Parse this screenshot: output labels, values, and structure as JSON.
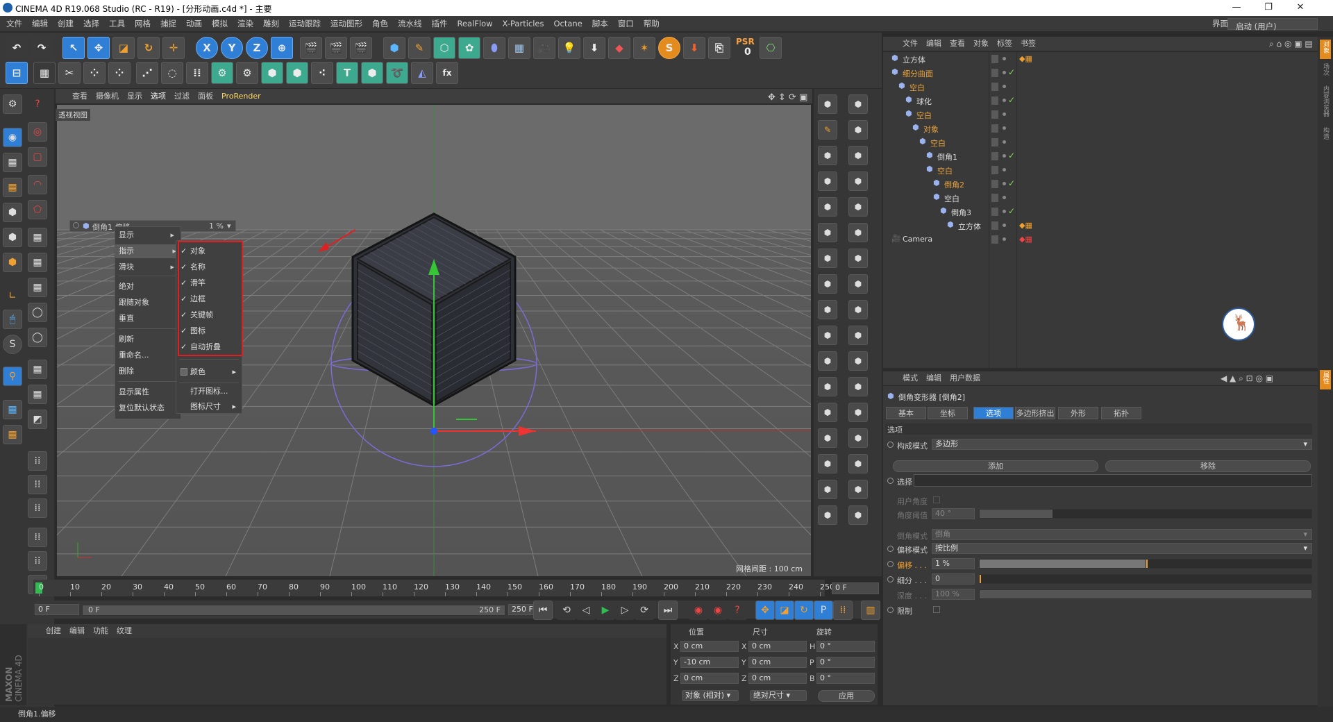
{
  "window": {
    "title": "CINEMA 4D R19.068 Studio (RC - R19) - [分形动画.c4d *] - 主要",
    "minimize": "—",
    "maximize": "❐",
    "close": "✕",
    "layout_label": "界面:",
    "layout_value": "启动 (用户)"
  },
  "menubar": [
    "文件",
    "编辑",
    "创建",
    "选择",
    "工具",
    "网格",
    "捕捉",
    "动画",
    "模拟",
    "渲染",
    "雕刻",
    "运动跟踪",
    "运动图形",
    "角色",
    "流水线",
    "插件",
    "RealFlow",
    "X-Particles",
    "Octane",
    "脚本",
    "窗口",
    "帮助"
  ],
  "top_toolbar": {
    "x_label": "X",
    "y_label": "Y",
    "z_label": "Z",
    "psr_label": "PSR",
    "psr_value": "0"
  },
  "viewport": {
    "menu": [
      "查看",
      "摄像机",
      "显示",
      "选项",
      "过滤",
      "面板",
      "ProRender"
    ],
    "label": "透视视图",
    "grid_readout": "网格间距 : 100 cm",
    "popup_object": "倒角1 偏移",
    "popup_value": "1 %"
  },
  "context_menu": {
    "items": [
      {
        "label": "显示",
        "arrow": "▸"
      },
      {
        "label": "指示",
        "arrow": "▸"
      },
      {
        "label": "滑块",
        "arrow": "▸"
      },
      {
        "label": "绝对"
      },
      {
        "label": "跟随对象"
      },
      {
        "label": "垂直"
      },
      {
        "label": "刷新"
      },
      {
        "label": "重命名..."
      },
      {
        "label": "删除"
      },
      {
        "label": "显示属性"
      },
      {
        "label": "复位默认状态"
      }
    ],
    "submenu": [
      {
        "label": "对象",
        "check": "✓"
      },
      {
        "label": "名称",
        "check": "✓"
      },
      {
        "label": "滑竿",
        "check": "✓"
      },
      {
        "label": "边框",
        "check": "✓"
      },
      {
        "label": "关键帧",
        "check": "✓"
      },
      {
        "label": "图标",
        "check": "✓"
      },
      {
        "label": "自动折叠",
        "check": "✓"
      },
      {
        "label": "颜色",
        "arrow": "▸"
      },
      {
        "label": "打开图标..."
      },
      {
        "label": "图标尺寸",
        "arrow": "▸"
      }
    ]
  },
  "timeline": {
    "ticks": [
      "0",
      "10",
      "20",
      "30",
      "40",
      "50",
      "60",
      "70",
      "80",
      "90",
      "100",
      "110",
      "120",
      "130",
      "140",
      "150",
      "160",
      "170",
      "180",
      "190",
      "200",
      "210",
      "220",
      "230",
      "240",
      "250"
    ],
    "current_frame": "0 F",
    "start_field": "0 F",
    "slider_start": "0 F",
    "slider_end": "250 F",
    "end_field": "250 F"
  },
  "object_manager": {
    "menu": [
      "文件",
      "编辑",
      "查看",
      "对象",
      "标签",
      "书签"
    ],
    "rows": [
      {
        "name": "立方体",
        "indent": 0,
        "color": "#dddddd",
        "check": ""
      },
      {
        "name": "细分曲面",
        "indent": 0,
        "color": "#e9a33b",
        "check": "✓"
      },
      {
        "name": "空白",
        "indent": 1,
        "color": "#e9a33b",
        "check": ""
      },
      {
        "name": "球化",
        "indent": 2,
        "color": "#dddddd",
        "check": "✓"
      },
      {
        "name": "空白",
        "indent": 2,
        "color": "#e9a33b",
        "check": ""
      },
      {
        "name": "对象",
        "indent": 3,
        "color": "#e9a33b",
        "check": ""
      },
      {
        "name": "空白",
        "indent": 4,
        "color": "#e9a33b",
        "check": ""
      },
      {
        "name": "倒角1",
        "indent": 5,
        "color": "#dddddd",
        "check": "✓"
      },
      {
        "name": "空白",
        "indent": 5,
        "color": "#e9a33b",
        "check": ""
      },
      {
        "name": "倒角2",
        "indent": 6,
        "color": "#e9a33b",
        "check": "✓"
      },
      {
        "name": "空白",
        "indent": 6,
        "color": "#dddddd",
        "check": ""
      },
      {
        "name": "倒角3",
        "indent": 7,
        "color": "#dddddd",
        "check": "✓"
      },
      {
        "name": "立方体",
        "indent": 8,
        "color": "#dddddd",
        "check": ""
      },
      {
        "name": "Camera",
        "indent": 0,
        "color": "#dddddd",
        "check": ""
      }
    ]
  },
  "attribute_manager": {
    "menu": [
      "模式",
      "编辑",
      "用户数据"
    ],
    "title": "倒角变形器 [倒角2]",
    "tabs": [
      "基本",
      "坐标",
      "选项",
      "多边形挤出",
      "外形",
      "拓扑"
    ],
    "section": "选项",
    "rows": {
      "build_mode_label": "构成模式",
      "build_mode_value": "多边形",
      "add_button": "添加",
      "remove_button": "移除",
      "selection_label": "选择",
      "user_angle_label": "用户角度",
      "angle_threshold_label": "角度阈值",
      "angle_threshold_value": "40 °",
      "bevel_mode_label": "倒角模式",
      "bevel_mode_value": "倒角",
      "offset_mode_label": "偏移模式",
      "offset_mode_value": "按比例",
      "offset_label": "偏移 . . .",
      "offset_value": "1 %",
      "offset_fraction": 0.01,
      "subdiv_label": "细分 . . .",
      "subdiv_value": "0",
      "depth_label": "深度 . . .",
      "depth_value": "100 %",
      "limit_label": "限制"
    }
  },
  "material_manager": {
    "menu": [
      "创建",
      "编辑",
      "功能",
      "纹理"
    ],
    "brand_top": "MAXON",
    "brand_bottom": "CINEMA 4D"
  },
  "coordinates": {
    "headers": [
      "位置",
      "尺寸",
      "旋转"
    ],
    "rows": [
      {
        "axis": "X",
        "pos": "0 cm",
        "size_axis": "X",
        "size": "0 cm",
        "rot_axis": "H",
        "rot": "0 °"
      },
      {
        "axis": "Y",
        "pos": "-10 cm",
        "size_axis": "Y",
        "size": "0 cm",
        "rot_axis": "P",
        "rot": "0 °"
      },
      {
        "axis": "Z",
        "pos": "0 cm",
        "size_axis": "Z",
        "size": "0 cm",
        "rot_axis": "B",
        "rot": "0 °"
      }
    ],
    "mode_select": "对象 (相对)",
    "size_select": "绝对尺寸",
    "apply_button": "应用"
  },
  "status_text": "倒角1.偏移",
  "right_tabs": [
    "对象",
    "场次",
    "内容浏览器",
    "构造"
  ],
  "right_tabs_bottom": [
    "属性"
  ]
}
